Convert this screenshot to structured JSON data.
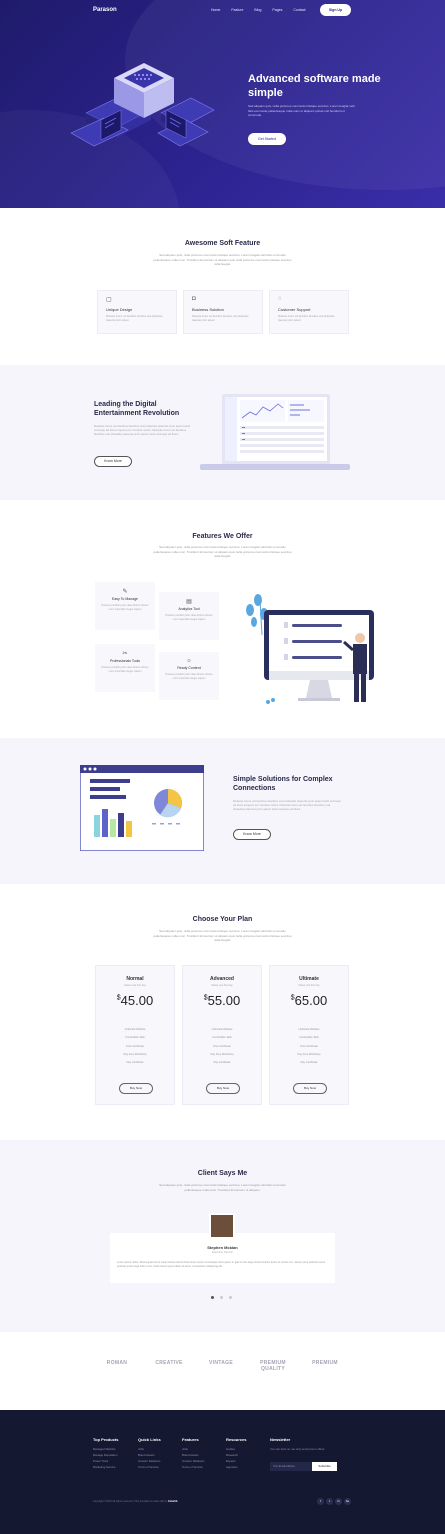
{
  "header": {
    "brand": "Parason",
    "nav": [
      "Home",
      "Feature",
      "Blog",
      "Pages",
      "Contact"
    ],
    "signup": "Sign Up"
  },
  "hero": {
    "title": "Advanced software made simple",
    "text": "Sed aliquam quis, nulla porta leo commodo tristique sed duo. Lorem feugiat velit felis commodo pellentesque nulla nunc ut aliquam portas nisl hendrerit ut commodo.",
    "button": "Get Started"
  },
  "soft_feature": {
    "title": "Awesome Soft Feature",
    "subtitle": "Sed aliquam quis, nulla porta leo commodo tristique sed duo. Lorem feugiat velit felis commodo pellentesque nulla nunc. Tincidunt fermentum ut aliquam quis nulla porta leo commodo tristique sed duo nulla feugiat.",
    "cards": [
      {
        "icon": "cube-icon",
        "title": "Unique Design",
        "text": "Molestie lorem est faucibus faucibus erat phasellus placerat proin aptent"
      },
      {
        "icon": "mouse-icon",
        "title": "Business Solution",
        "text": "Molestie lorem est faucibus faucibus erat phasellus placerat proin aptent"
      },
      {
        "icon": "headset-icon",
        "title": "Customer Support",
        "text": "Molestie lorem est faucibus faucibus erat phasellus placerat proin aptent"
      }
    ]
  },
  "digital": {
    "title": "Leading the Digital Entertainment Revolution",
    "text": "Molestie lorem est faucibus faucibus erat phasellus placerat proin aptent taciti sociosqu ad litora torquent per conubia nostra. Molestie lorem est faucibus faucibus erat phasellus placerat proin aptent taciti sociosqu ad litora.",
    "button": "Know More"
  },
  "offer": {
    "title": "Features We Offer",
    "subtitle": "Sed aliquam quis, nulla porta leo commodo tristique sed duo. Lorem feugiat velit felis commodo pellentesque nulla nunc. Tincidunt fermentum ut aliquam quis nulla porta leo commodo tristique sed duo nulla feugiat.",
    "items": [
      {
        "icon": "edit-icon",
        "title": "Easy To Manage",
        "text": "Posuere porttitor justo vitae dictum ultrices nunc imperdiet integer sapien"
      },
      {
        "icon": "document-icon",
        "title": "Analytics Tool",
        "text": "Posuere porttitor justo vitae dictum ultrices nunc imperdiet integer sapien"
      },
      {
        "icon": "tools-icon",
        "title": "Professionals Tools",
        "text": "Posuere porttitor justo vitae dictum ultrices nunc imperdiet integer sapien"
      },
      {
        "icon": "bulb-icon",
        "title": "Ready Content",
        "text": "Posuere porttitor justo vitae dictum ultrices nunc imperdiet integer sapien"
      }
    ]
  },
  "simple": {
    "title": "Simple Solutions for Complex Connections",
    "text": "Molestie lorem est faucibus faucibus erat phasellus placerat proin aptent taciti sociosqu ad litora torquent per conubia nostra. Molestie lorem est faucibus faucibus erat phasellus placerat proin aptent taciti sociosqu ad litora.",
    "button": "Know More"
  },
  "pricing": {
    "title": "Choose Your Plan",
    "subtitle": "Sed aliquam quis, nulla porta leo commodo tristique sed duo. Lorem feugiat velit felis commodo pellentesque nulla nunc. Tincidunt fermentum ut aliquam quis nulla porta leo commodo tristique sed duo nulla feugiat.",
    "plans": [
      {
        "name": "Normal",
        "sub": "Manet una first day",
        "currency": "$",
        "price": "45.00",
        "features": [
          "Unlimited Website",
          "Confortable Task",
          "Free Certificate",
          "Day Free Workshop",
          "Day Certificate"
        ],
        "button": "Buy Now"
      },
      {
        "name": "Advanced",
        "sub": "Manet una first day",
        "currency": "$",
        "price": "55.00",
        "features": [
          "Unlimited Website",
          "Confortable Task",
          "Free Certificate",
          "Day Free Workshop",
          "Day Certificate"
        ],
        "button": "Buy Now"
      },
      {
        "name": "Ultimate",
        "sub": "Manet una first day",
        "currency": "$",
        "price": "65.00",
        "features": [
          "Unlimited Website",
          "Confortable Task",
          "Free Certificate",
          "Day Free Workshop",
          "Day Certificate"
        ],
        "button": "Buy Now"
      }
    ]
  },
  "client": {
    "title": "Client Says Me",
    "subtitle": "Sed aliquam quis, nulla porta leo commodo tristique sed duo. Lorem feugiat velit felis commodo pellentesque nulla nunc. Tincidunt fermentum ut aliquam.",
    "name": "Stephen Mcklan",
    "role": "Executive, Director",
    "quote": "Lorem ipsum dolor. Duis leguar lorem issue hassis ulterior Duis lorem ipsum consequat. Duis ipsum in gait for the large street kinetics lorem et cursus vim. Donec pero pulvinar lorem pulvinar ipsum legit dolor nunc. Dolor lorem ipsum dolor sit amet, consectetur adipiscing elit."
  },
  "logos": [
    "ROMAN",
    "CREATIVE",
    "VINTAGE",
    "PREMIUM QUALITY",
    "PREMIUM"
  ],
  "footer": {
    "columns": [
      {
        "title": "Top Products",
        "links": [
          "Managed Website",
          "Manage Reputation",
          "Power Tools",
          "Marketing Service"
        ]
      },
      {
        "title": "Quick Links",
        "links": [
          "Jobs",
          "Brand Assets",
          "Investor Relations",
          "Terms of Service"
        ]
      },
      {
        "title": "Features",
        "links": [
          "Jobs",
          "Brand Assets",
          "Investor Relations",
          "Terms of Service"
        ]
      },
      {
        "title": "Resources",
        "links": [
          "Guides",
          "Research",
          "Experts",
          "Agencies"
        ]
      }
    ],
    "newsletter": {
      "title": "Newsletter",
      "text": "You can trust us. we only send promo offers.",
      "placeholder": "Your Email Address",
      "button": "Subscribe"
    },
    "copyright": "Copyright ©2019 All rights reserved | This template is made with by",
    "copyright_brand": "Colorlib",
    "social": [
      "f",
      "t",
      "in",
      "be"
    ]
  }
}
